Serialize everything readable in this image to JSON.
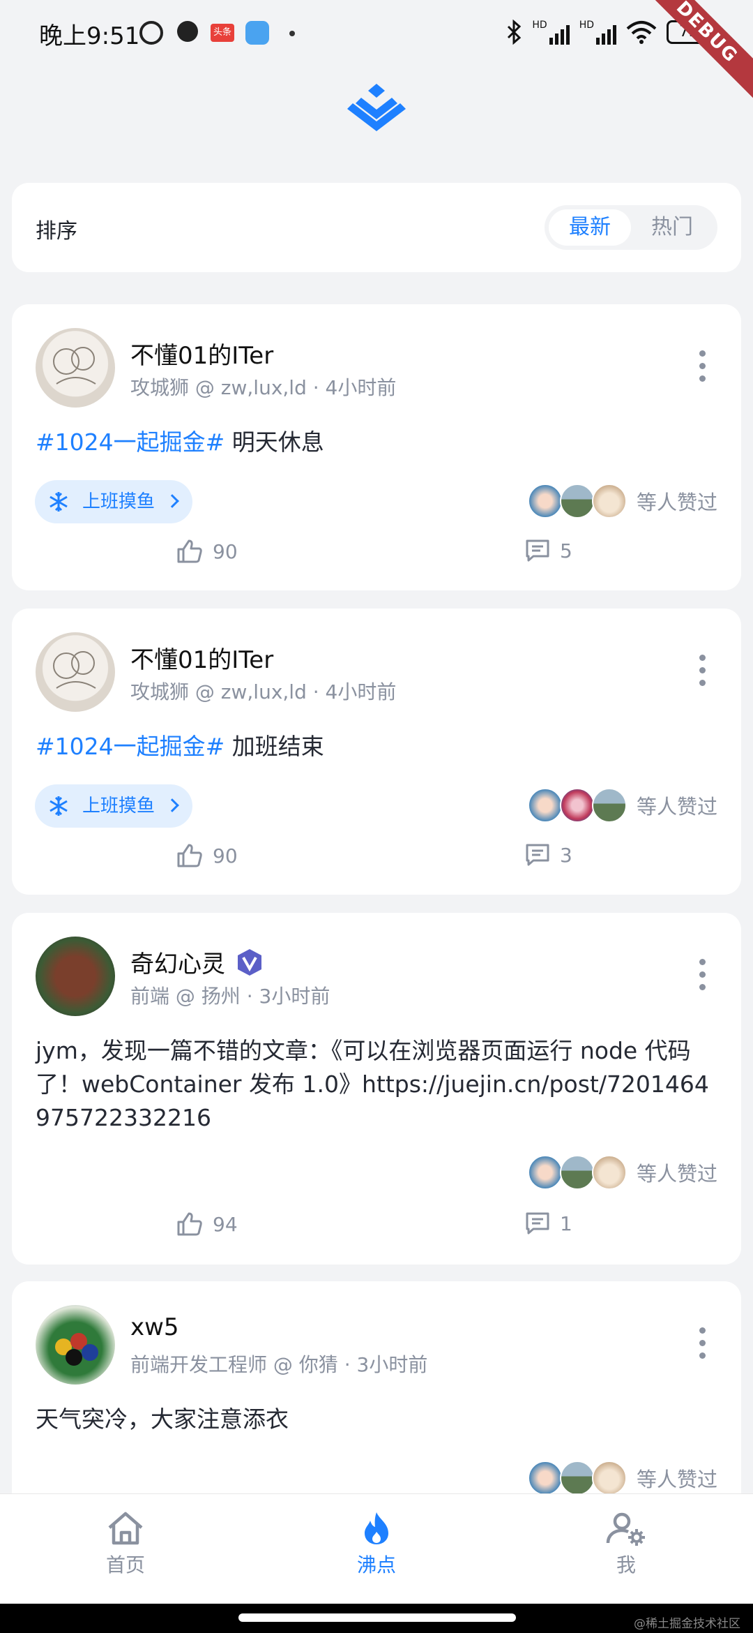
{
  "status_bar": {
    "time": "晚上9:51",
    "toutiao": "头条",
    "hd1": "HD",
    "hd2": "HD",
    "battery": "73",
    "debug": "DEBUG"
  },
  "sort": {
    "label": "排序",
    "options": [
      "最新",
      "热门"
    ],
    "selected": "最新"
  },
  "posts": [
    {
      "author": "不懂01的ITer",
      "meta": "攻城狮 @ zw,lux,ld · 4小时前",
      "topic": "#1024一起掘金#",
      "text": " 明天休息",
      "circle": "上班摸鱼",
      "liked_suffix": "等人赞过",
      "likes": "90",
      "comments": "5"
    },
    {
      "author": "不懂01的ITer",
      "meta": "攻城狮 @ zw,lux,ld · 4小时前",
      "topic": "#1024一起掘金#",
      "text": " 加班结束",
      "circle": "上班摸鱼",
      "liked_suffix": "等人赞过",
      "likes": "90",
      "comments": "3"
    },
    {
      "author": "奇幻心灵",
      "meta": "前端 @ 扬州 · 3小时前",
      "text": "jym，发现一篇不错的文章：《可以在浏览器页面运行 node 代码了！webContainer 发布 1.0》https://juejin.cn/post/7201464975722332216",
      "liked_suffix": "等人赞过",
      "likes": "94",
      "comments": "1"
    },
    {
      "author": "xw5",
      "meta": "前端开发工程师 @ 你猜 · 3小时前",
      "text": "天气突冷，大家注意添衣",
      "liked_suffix": "等人赞过"
    }
  ],
  "tabbar": {
    "items": [
      {
        "label": "首页",
        "icon": "home-icon"
      },
      {
        "label": "沸点",
        "icon": "flame-icon"
      },
      {
        "label": "我",
        "icon": "user-settings-icon"
      }
    ],
    "active": "沸点"
  },
  "watermark": "@稀土掘金技术社区",
  "colors": {
    "accent": "#1e80ff",
    "muted": "#8a919f",
    "background": "#f2f3f5",
    "debug_ribbon": "#b4383e"
  }
}
